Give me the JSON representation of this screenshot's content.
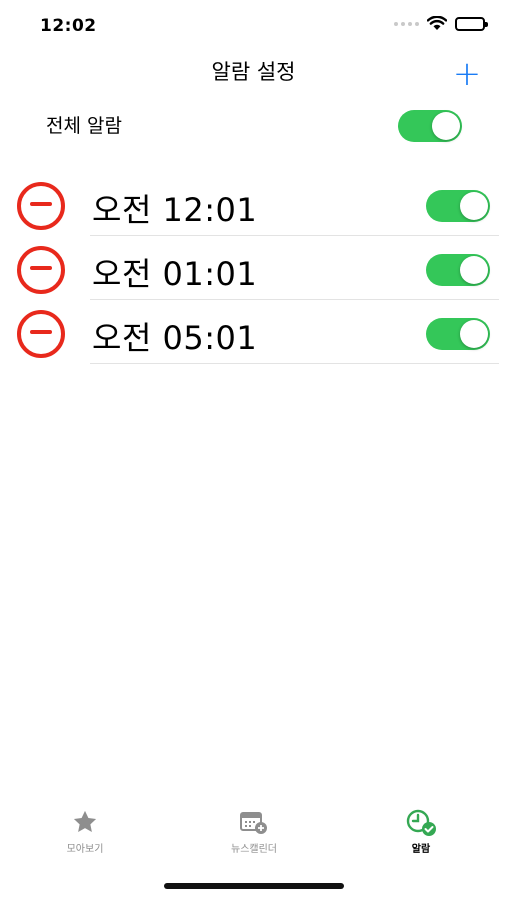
{
  "status_bar": {
    "time": "12:02"
  },
  "nav": {
    "title": "알람 설정",
    "add_label": "+"
  },
  "master": {
    "label": "전체 알람",
    "enabled": true
  },
  "alarms": [
    {
      "time": "오전 12:01",
      "enabled": true
    },
    {
      "time": "오전 01:01",
      "enabled": true
    },
    {
      "time": "오전 05:01",
      "enabled": true
    }
  ],
  "tabs": [
    {
      "label": "모아보기",
      "icon": "star-icon",
      "active": false
    },
    {
      "label": "뉴스캘린더",
      "icon": "calendar-icon",
      "active": false
    },
    {
      "label": "알람",
      "icon": "clock-check-icon",
      "active": true
    }
  ],
  "colors": {
    "accent": "#1a7cf5",
    "toggle_on": "#34c759",
    "delete": "#e8291c",
    "tab_active": "#34a853"
  }
}
